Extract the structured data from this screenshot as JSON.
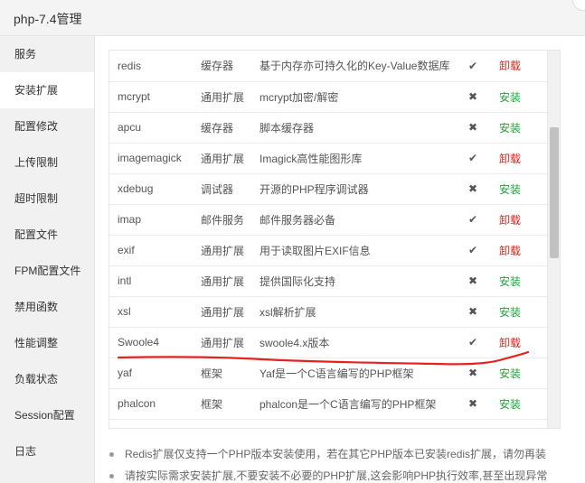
{
  "window": {
    "title": "php-7.4管理"
  },
  "sidebar": {
    "items": [
      {
        "label": "服务",
        "key": "service",
        "active": false
      },
      {
        "label": "安装扩展",
        "key": "install-extension",
        "active": true
      },
      {
        "label": "配置修改",
        "key": "config-edit",
        "active": false
      },
      {
        "label": "上传限制",
        "key": "upload-limit",
        "active": false
      },
      {
        "label": "超时限制",
        "key": "timeout-limit",
        "active": false
      },
      {
        "label": "配置文件",
        "key": "config-file",
        "active": false
      },
      {
        "label": "FPM配置文件",
        "key": "fpm-config-file",
        "active": false
      },
      {
        "label": "禁用函数",
        "key": "disabled-functions",
        "active": false
      },
      {
        "label": "性能调整",
        "key": "performance",
        "active": false
      },
      {
        "label": "负载状态",
        "key": "load-status",
        "active": false
      },
      {
        "label": "Session配置",
        "key": "session-config",
        "active": false
      },
      {
        "label": "日志",
        "key": "logs",
        "active": false
      }
    ]
  },
  "extensions": [
    {
      "name": "redis",
      "type": "缓存器",
      "desc": "基于内存亦可持久化的Key-Value数据库",
      "status": "✔",
      "installed": true,
      "action": "卸载"
    },
    {
      "name": "mcrypt",
      "type": "通用扩展",
      "desc": "mcrypt加密/解密",
      "status": "✖",
      "installed": false,
      "action": "安装"
    },
    {
      "name": "apcu",
      "type": "缓存器",
      "desc": "脚本缓存器",
      "status": "✖",
      "installed": false,
      "action": "安装"
    },
    {
      "name": "imagemagick",
      "type": "通用扩展",
      "desc": "Imagick高性能图形库",
      "status": "✔",
      "installed": true,
      "action": "卸载"
    },
    {
      "name": "xdebug",
      "type": "调试器",
      "desc": "开源的PHP程序调试器",
      "status": "✖",
      "installed": false,
      "action": "安装"
    },
    {
      "name": "imap",
      "type": "邮件服务",
      "desc": "邮件服务器必备",
      "status": "✔",
      "installed": true,
      "action": "卸载"
    },
    {
      "name": "exif",
      "type": "通用扩展",
      "desc": "用于读取图片EXIF信息",
      "status": "✔",
      "installed": true,
      "action": "卸载"
    },
    {
      "name": "intl",
      "type": "通用扩展",
      "desc": "提供国际化支持",
      "status": "✖",
      "installed": false,
      "action": "安装"
    },
    {
      "name": "xsl",
      "type": "通用扩展",
      "desc": "xsl解析扩展",
      "status": "✖",
      "installed": false,
      "action": "安装"
    },
    {
      "name": "Swoole4",
      "type": "通用扩展",
      "desc": "swoole4.x版本",
      "status": "✔",
      "installed": true,
      "action": "卸载"
    },
    {
      "name": "yaf",
      "type": "框架",
      "desc": "Yaf是一个C语言编写的PHP框架",
      "status": "✖",
      "installed": false,
      "action": "安装"
    },
    {
      "name": "phalcon",
      "type": "框架",
      "desc": "phalcon是一个C语言编写的PHP框架",
      "status": "✖",
      "installed": false,
      "action": "安装"
    }
  ],
  "notes": [
    "Redis扩展仅支持一个PHP版本安装使用，若在其它PHP版本已安装redis扩展，请勿再装",
    "请按实际需求安装扩展,不要安装不必要的PHP扩展,这会影响PHP执行效率,甚至出现异常"
  ],
  "colors": {
    "install": "#20a53a",
    "uninstall": "#d9261c",
    "annotation": "#e8211f"
  }
}
